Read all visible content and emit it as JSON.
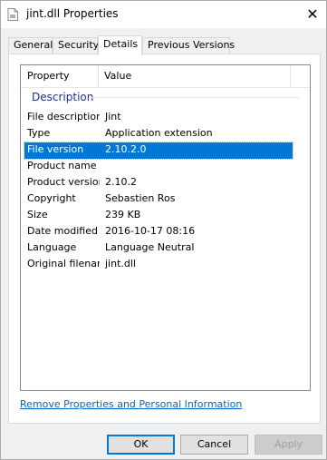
{
  "window": {
    "title": "jint.dll Properties",
    "close_glyph": "✕",
    "accent": "#0078d7"
  },
  "tabs": [
    {
      "label": "General"
    },
    {
      "label": "Security"
    },
    {
      "label": "Details",
      "active": true
    },
    {
      "label": "Previous Versions"
    }
  ],
  "details": {
    "columns": {
      "property": "Property",
      "value": "Value"
    },
    "group": "Description",
    "rows": [
      {
        "property": "File description",
        "value": "Jint"
      },
      {
        "property": "Type",
        "value": "Application extension"
      },
      {
        "property": "File version",
        "value": "2.10.2.0",
        "selected": true
      },
      {
        "property": "Product name",
        "value": ""
      },
      {
        "property": "Product version",
        "value": "2.10.2"
      },
      {
        "property": "Copyright",
        "value": "Sebastien Ros"
      },
      {
        "property": "Size",
        "value": "239 KB"
      },
      {
        "property": "Date modified",
        "value": "2016-10-17 08:16"
      },
      {
        "property": "Language",
        "value": "Language Neutral"
      },
      {
        "property": "Original filename",
        "value": "jint.dll"
      }
    ]
  },
  "link": {
    "label": "Remove Properties and Personal Information"
  },
  "buttons": {
    "ok": "OK",
    "cancel": "Cancel",
    "apply": "Apply"
  }
}
